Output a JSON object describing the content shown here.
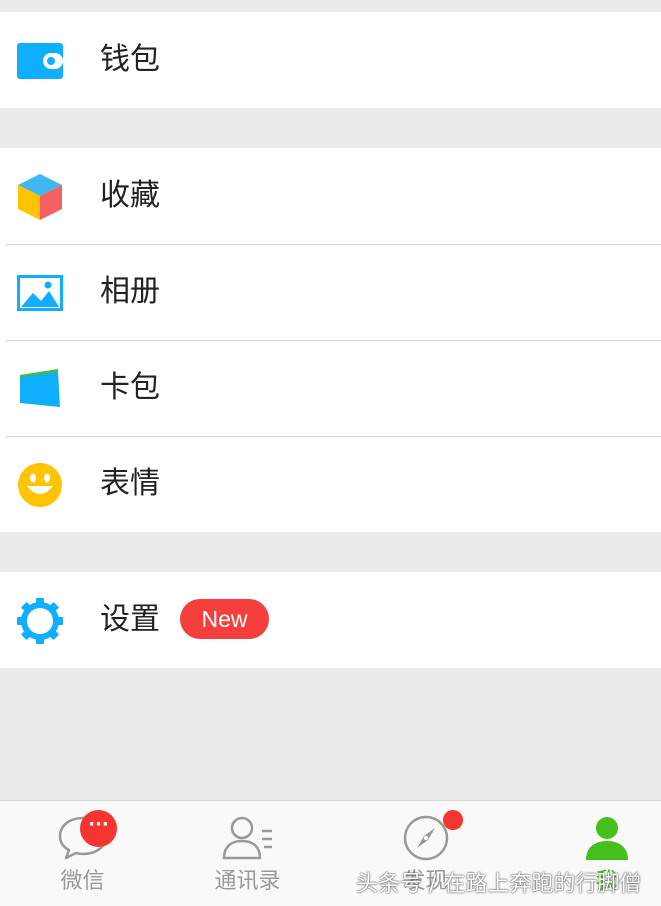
{
  "menu": {
    "wallet": "钱包",
    "favorites": "收藏",
    "album": "相册",
    "cards": "卡包",
    "stickers": "表情",
    "settings": "设置",
    "settings_badge": "New"
  },
  "tabbar": {
    "chats": "微信",
    "chats_badge": "···",
    "contacts": "通讯录",
    "discover": "发现",
    "me": "我",
    "active": "me"
  },
  "watermark": "头条号 / 在路上奔跑的行脚僧",
  "colors": {
    "accent_green": "#45c01a",
    "badge_red": "#f43530",
    "icon_blue": "#10aeff",
    "emoji_yellow": "#ffc300"
  }
}
